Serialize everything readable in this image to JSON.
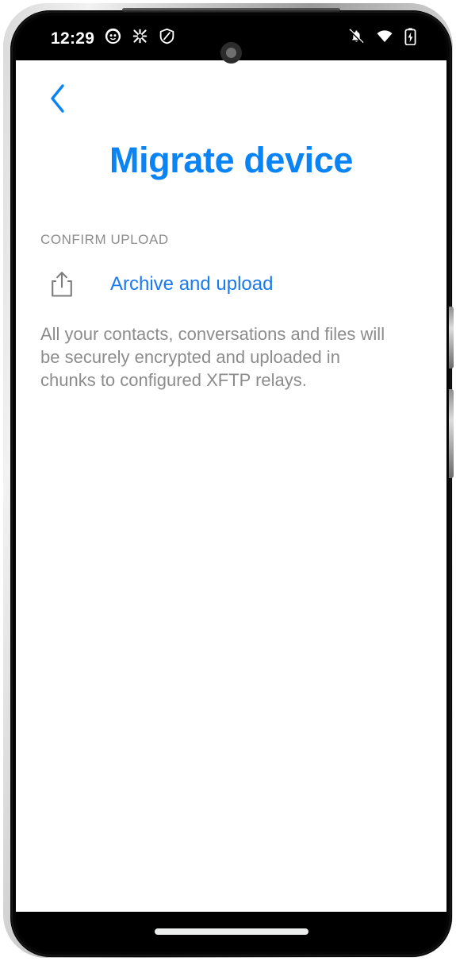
{
  "status_bar": {
    "clock": "12:29",
    "left_icons": [
      {
        "name": "cat-face-icon",
        "label": "cat face"
      },
      {
        "name": "orbot-icon",
        "label": "orbot"
      },
      {
        "name": "shield-vpn-icon",
        "label": "shield"
      }
    ],
    "right_icons": [
      {
        "name": "ringer-muted-icon",
        "label": "ringer muted"
      },
      {
        "name": "wifi-icon",
        "label": "wifi"
      },
      {
        "name": "battery-charging-icon",
        "label": "battery charging"
      }
    ]
  },
  "navigation": {
    "back_label": "Back"
  },
  "header": {
    "title": "Migrate device"
  },
  "main": {
    "section_header": "CONFIRM UPLOAD",
    "action": {
      "label": "Archive and upload",
      "icon": "share-upload-icon"
    },
    "description": "All your contacts, conversations and files will be securely encrypted and uploaded in chunks to configured XFTP relays."
  },
  "colors": {
    "accent_blue": "#0a84f5",
    "link_blue": "#1a7af0",
    "muted_gray": "#8c8c8c",
    "background": "#ffffff",
    "system_black": "#000000"
  },
  "system_nav": {
    "gesture_bar": "home gesture bar"
  }
}
